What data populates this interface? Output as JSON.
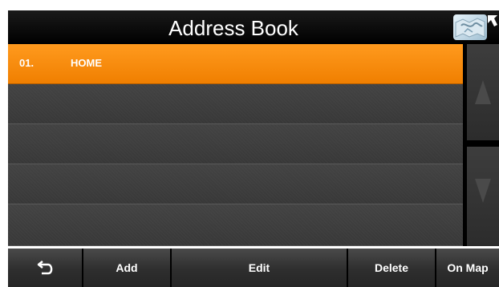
{
  "header": {
    "title": "Address Book",
    "map_icon": "map-icon",
    "corner_icon": "arrow-up-left-icon"
  },
  "list": {
    "items": [
      {
        "index": "01.",
        "name": "HOME",
        "selected": true
      },
      {
        "index": "",
        "name": "",
        "selected": false
      },
      {
        "index": "",
        "name": "",
        "selected": false
      },
      {
        "index": "",
        "name": "",
        "selected": false
      },
      {
        "index": "",
        "name": "",
        "selected": false
      }
    ]
  },
  "scroll": {
    "up_icon": "arrow-up-icon",
    "down_icon": "arrow-down-icon"
  },
  "toolbar": {
    "back_icon": "back-arrow-icon",
    "add_label": "Add",
    "edit_label": "Edit",
    "delete_label": "Delete",
    "onmap_label": "On Map"
  },
  "colors": {
    "selected_row": "#ff8c0a",
    "row_bg": "#3c3c3c",
    "header_bg": "#000000"
  }
}
